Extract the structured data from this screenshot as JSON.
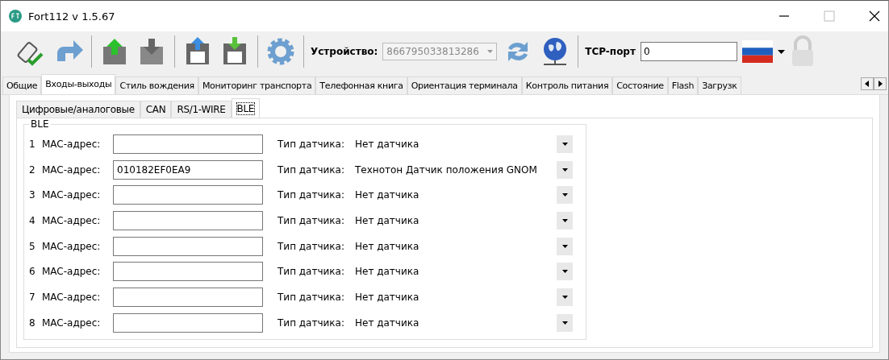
{
  "window": {
    "title": "Fort112 v 1.5.67"
  },
  "toolbar": {
    "device_label": "Устройство:",
    "device_value": "866795033813286",
    "tcp_label": "TCP-порт",
    "tcp_value": "0"
  },
  "tabs": [
    {
      "label": "Общие",
      "selected": false
    },
    {
      "label": "Входы-выходы",
      "selected": true
    },
    {
      "label": "Стиль вождения",
      "selected": false
    },
    {
      "label": "Мониторинг транспорта",
      "selected": false
    },
    {
      "label": "Телефонная книга",
      "selected": false
    },
    {
      "label": "Ориентация терминала",
      "selected": false
    },
    {
      "label": "Контроль питания",
      "selected": false
    },
    {
      "label": "Состояние",
      "selected": false
    },
    {
      "label": "Flash",
      "selected": false
    },
    {
      "label": "Загрузк",
      "selected": false
    }
  ],
  "subtabs": [
    {
      "label": "Цифровые/аналоговые",
      "selected": false
    },
    {
      "label": "CAN",
      "selected": false
    },
    {
      "label": "RS/1-WIRE",
      "selected": false
    },
    {
      "label": "BLE",
      "selected": true
    }
  ],
  "group": {
    "title": "BLE",
    "rows": [
      {
        "index": "1",
        "mac_label": "MAC-адрес:",
        "mac": "",
        "type_label": "Тип датчика:",
        "sensor": "Нет датчика"
      },
      {
        "index": "2",
        "mac_label": "MAC-адрес:",
        "mac": "010182EF0EA9",
        "type_label": "Тип датчика:",
        "sensor": "Технотон Датчик положения GNOM"
      },
      {
        "index": "3",
        "mac_label": "MAC-адрес:",
        "mac": "",
        "type_label": "Тип датчика:",
        "sensor": "Нет датчика"
      },
      {
        "index": "4",
        "mac_label": "MAC-адрес:",
        "mac": "",
        "type_label": "Тип датчика:",
        "sensor": "Нет датчика"
      },
      {
        "index": "5",
        "mac_label": "MAC-адрес:",
        "mac": "",
        "type_label": "Тип датчика:",
        "sensor": "Нет датчика"
      },
      {
        "index": "6",
        "mac_label": "MAC-адрес:",
        "mac": "",
        "type_label": "Тип датчика:",
        "sensor": "Нет датчика"
      },
      {
        "index": "7",
        "mac_label": "MAC-адрес:",
        "mac": "",
        "type_label": "Тип датчика:",
        "sensor": "Нет датчика"
      },
      {
        "index": "8",
        "mac_label": "MAC-адрес:",
        "mac": "",
        "type_label": "Тип датчика:",
        "sensor": "Нет датчика"
      }
    ]
  }
}
